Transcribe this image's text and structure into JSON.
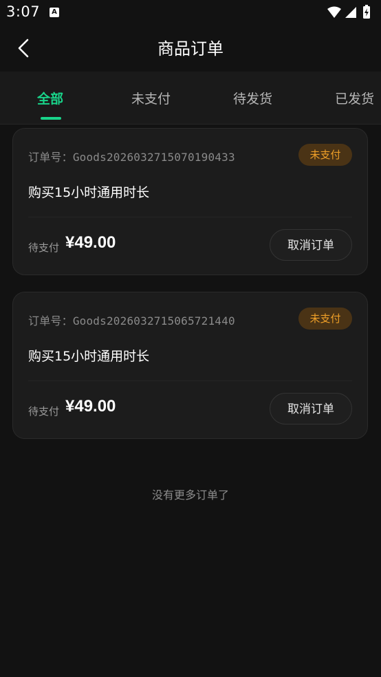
{
  "status_bar": {
    "time": "3:07",
    "notification_icon_letter": "A",
    "icons": [
      "wifi-icon",
      "signal-icon",
      "battery-charging-icon"
    ]
  },
  "header": {
    "title": "商品订单",
    "back_icon": "chevron-left-icon"
  },
  "tabs": [
    {
      "label": "全部",
      "active": true
    },
    {
      "label": "未支付",
      "active": false
    },
    {
      "label": "待发货",
      "active": false
    },
    {
      "label": "已发货",
      "active": false
    }
  ],
  "orders": [
    {
      "order_no_label": "订单号：",
      "order_no": "Goods2026032715070190433",
      "status": "未支付",
      "product": "购买15小时通用时长",
      "price_label": "待支付",
      "price": "¥49.00",
      "action": "取消订单"
    },
    {
      "order_no_label": "订单号：",
      "order_no": "Goods2026032715065721440",
      "status": "未支付",
      "product": "购买15小时通用时长",
      "price_label": "待支付",
      "price": "¥49.00",
      "action": "取消订单"
    }
  ],
  "footer": {
    "no_more_text": "没有更多订单了"
  },
  "colors": {
    "background": "#121212",
    "card": "#1c1c1c",
    "accent": "#19d48a",
    "badge_bg": "#4a3315",
    "badge_text": "#f0a028"
  }
}
